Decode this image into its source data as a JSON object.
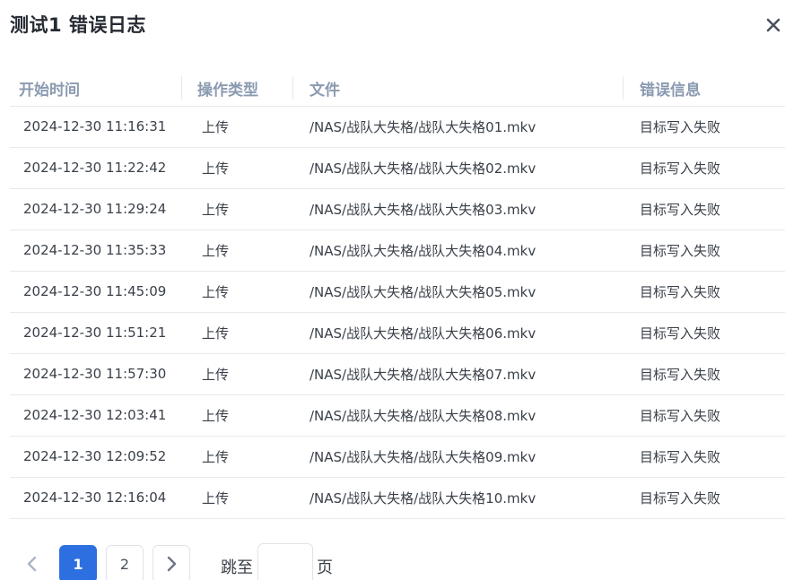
{
  "dialog": {
    "title": "测试1 错误日志",
    "close_icon": "close-icon"
  },
  "table": {
    "columns": [
      "开始时间",
      "操作类型",
      "文件",
      "错误信息"
    ],
    "rows": [
      {
        "time": "2024-12-30 11:16:31",
        "type": "上传",
        "file": "/NAS/战队大失格/战队大失格01.mkv",
        "error": "目标写入失败"
      },
      {
        "time": "2024-12-30 11:22:42",
        "type": "上传",
        "file": "/NAS/战队大失格/战队大失格02.mkv",
        "error": "目标写入失败"
      },
      {
        "time": "2024-12-30 11:29:24",
        "type": "上传",
        "file": "/NAS/战队大失格/战队大失格03.mkv",
        "error": "目标写入失败"
      },
      {
        "time": "2024-12-30 11:35:33",
        "type": "上传",
        "file": "/NAS/战队大失格/战队大失格04.mkv",
        "error": "目标写入失败"
      },
      {
        "time": "2024-12-30 11:45:09",
        "type": "上传",
        "file": "/NAS/战队大失格/战队大失格05.mkv",
        "error": "目标写入失败"
      },
      {
        "time": "2024-12-30 11:51:21",
        "type": "上传",
        "file": "/NAS/战队大失格/战队大失格06.mkv",
        "error": "目标写入失败"
      },
      {
        "time": "2024-12-30 11:57:30",
        "type": "上传",
        "file": "/NAS/战队大失格/战队大失格07.mkv",
        "error": "目标写入失败"
      },
      {
        "time": "2024-12-30 12:03:41",
        "type": "上传",
        "file": "/NAS/战队大失格/战队大失格08.mkv",
        "error": "目标写入失败"
      },
      {
        "time": "2024-12-30 12:09:52",
        "type": "上传",
        "file": "/NAS/战队大失格/战队大失格09.mkv",
        "error": "目标写入失败"
      },
      {
        "time": "2024-12-30 12:16:04",
        "type": "上传",
        "file": "/NAS/战队大失格/战队大失格10.mkv",
        "error": "目标写入失败"
      }
    ]
  },
  "pagination": {
    "prev_icon": "chevron-left-icon",
    "next_icon": "chevron-right-icon",
    "pages": [
      "1",
      "2"
    ],
    "current_page": "1",
    "jump_label": "跳至",
    "jump_value": "",
    "jump_suffix": "页"
  },
  "colors": {
    "accent": "#2d6fe0",
    "header_text": "#8a9ab0",
    "border": "#e6e9ee"
  }
}
